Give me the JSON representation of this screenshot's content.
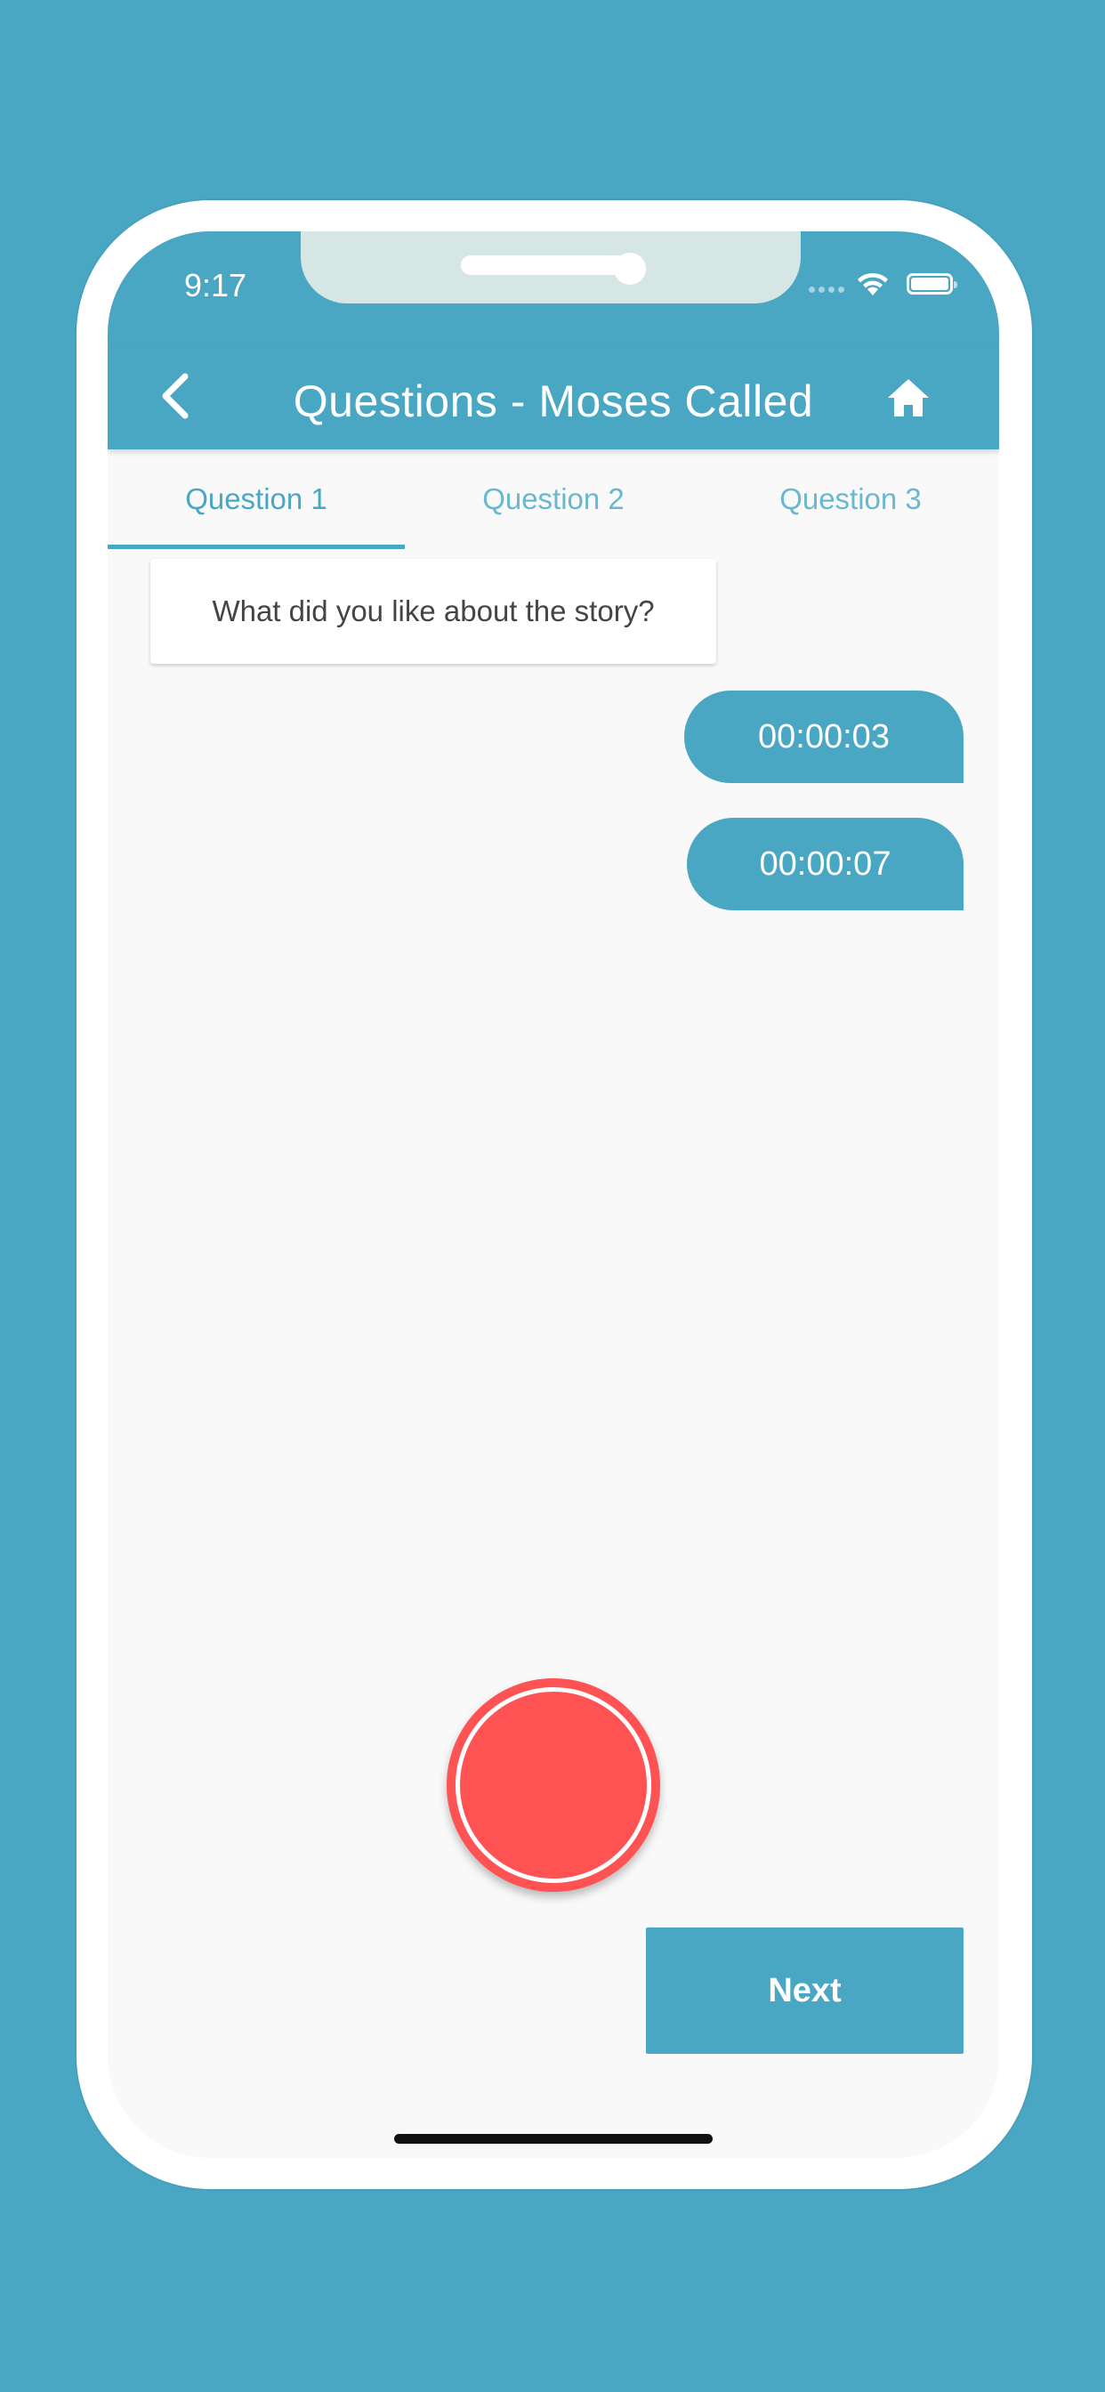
{
  "status_bar": {
    "time": "9:17"
  },
  "app_bar": {
    "title": "Questions - Moses Called"
  },
  "tabs": [
    {
      "label": "Question 1",
      "active": true
    },
    {
      "label": "Question 2",
      "active": false
    },
    {
      "label": "Question 3",
      "active": false
    }
  ],
  "question": {
    "text": "What did you like about the story?"
  },
  "recordings": [
    {
      "duration": "00:00:03"
    },
    {
      "duration": "00:00:07"
    }
  ],
  "next_button": {
    "label": "Next"
  },
  "colors": {
    "primary": "#4aa7c3",
    "record": "#ff5252",
    "background": "#f9f9f9"
  },
  "icons": {
    "back": "chevron-left-icon",
    "home": "home-icon",
    "wifi": "wifi-icon",
    "battery": "battery-icon"
  }
}
